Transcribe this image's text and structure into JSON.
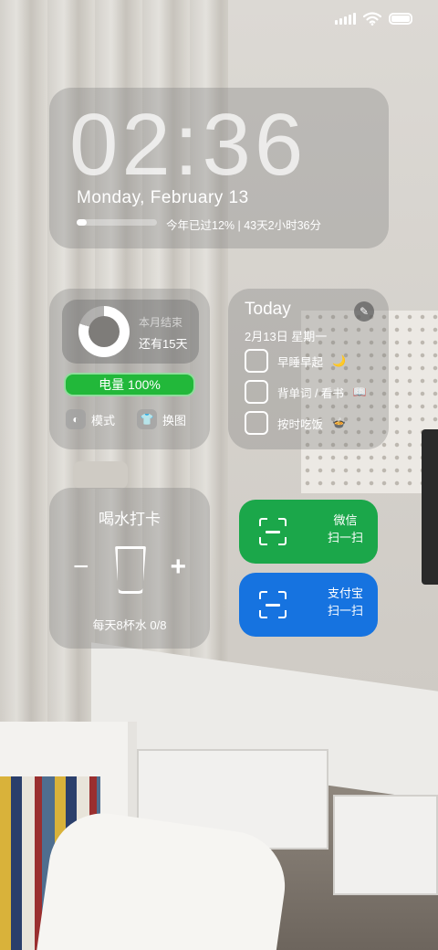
{
  "status_bar": {
    "icons": [
      "signal-icon",
      "wifi-icon",
      "battery-icon"
    ]
  },
  "clock": {
    "time": "02:36",
    "date": "Monday, February  13",
    "year_progress": 0.12,
    "year_text": "今年已过12%  |  43天2小时36分"
  },
  "battery_widget": {
    "month_title": "本月结束",
    "month_remaining": "还有15天",
    "month_progress": 0.8,
    "power_label": "电量 100%",
    "mode_label": "模式",
    "change_wallpaper_label": "换图"
  },
  "todo": {
    "title": "Today",
    "date": "2月13日  星期一",
    "items": [
      {
        "label": "早睡早起",
        "emoji": "🌙"
      },
      {
        "label": "背单词 / 看书",
        "emoji": "📖"
      },
      {
        "label": "按时吃饭",
        "emoji": "🍲"
      }
    ]
  },
  "water": {
    "title": "喝水打卡",
    "minus": "−",
    "plus": "+",
    "count_text": "每天8杯水 0/8"
  },
  "wechat": {
    "name": "微信",
    "action": "扫一扫",
    "color": "#1ba74a"
  },
  "alipay": {
    "name": "支付宝",
    "action": "扫一扫",
    "color": "#1673e0"
  }
}
